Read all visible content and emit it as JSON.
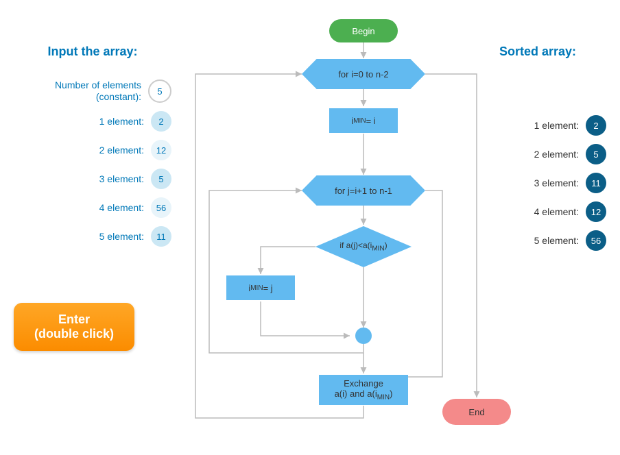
{
  "left": {
    "title": "Input the array:",
    "constant_label": "Number of elements (constant):",
    "constant_value": "5",
    "elements": [
      {
        "label": "1 element:",
        "value": "2"
      },
      {
        "label": "2 element:",
        "value": "12"
      },
      {
        "label": "3 element:",
        "value": "5"
      },
      {
        "label": "4 element:",
        "value": "56"
      },
      {
        "label": "5 element:",
        "value": "11"
      }
    ],
    "button_line1": "Enter",
    "button_line2": "(double click)"
  },
  "right": {
    "title": "Sorted array:",
    "elements": [
      {
        "label": "1 element:",
        "value": "2"
      },
      {
        "label": "2 element:",
        "value": "5"
      },
      {
        "label": "3 element:",
        "value": "11"
      },
      {
        "label": "4 element:",
        "value": "12"
      },
      {
        "label": "5 element:",
        "value": "56"
      }
    ]
  },
  "flowchart": {
    "begin": "Begin",
    "outer_loop": "for i=0 to n-2",
    "imin_i": "iMIN = i",
    "inner_loop": "for j=i+1 to n-1",
    "condition": "if a(j)<a(iMIN)",
    "imin_j": "iMIN = j",
    "exchange_line1": "Exchange",
    "exchange_line2": "a(i) and a(iMIN)",
    "end": "End"
  }
}
